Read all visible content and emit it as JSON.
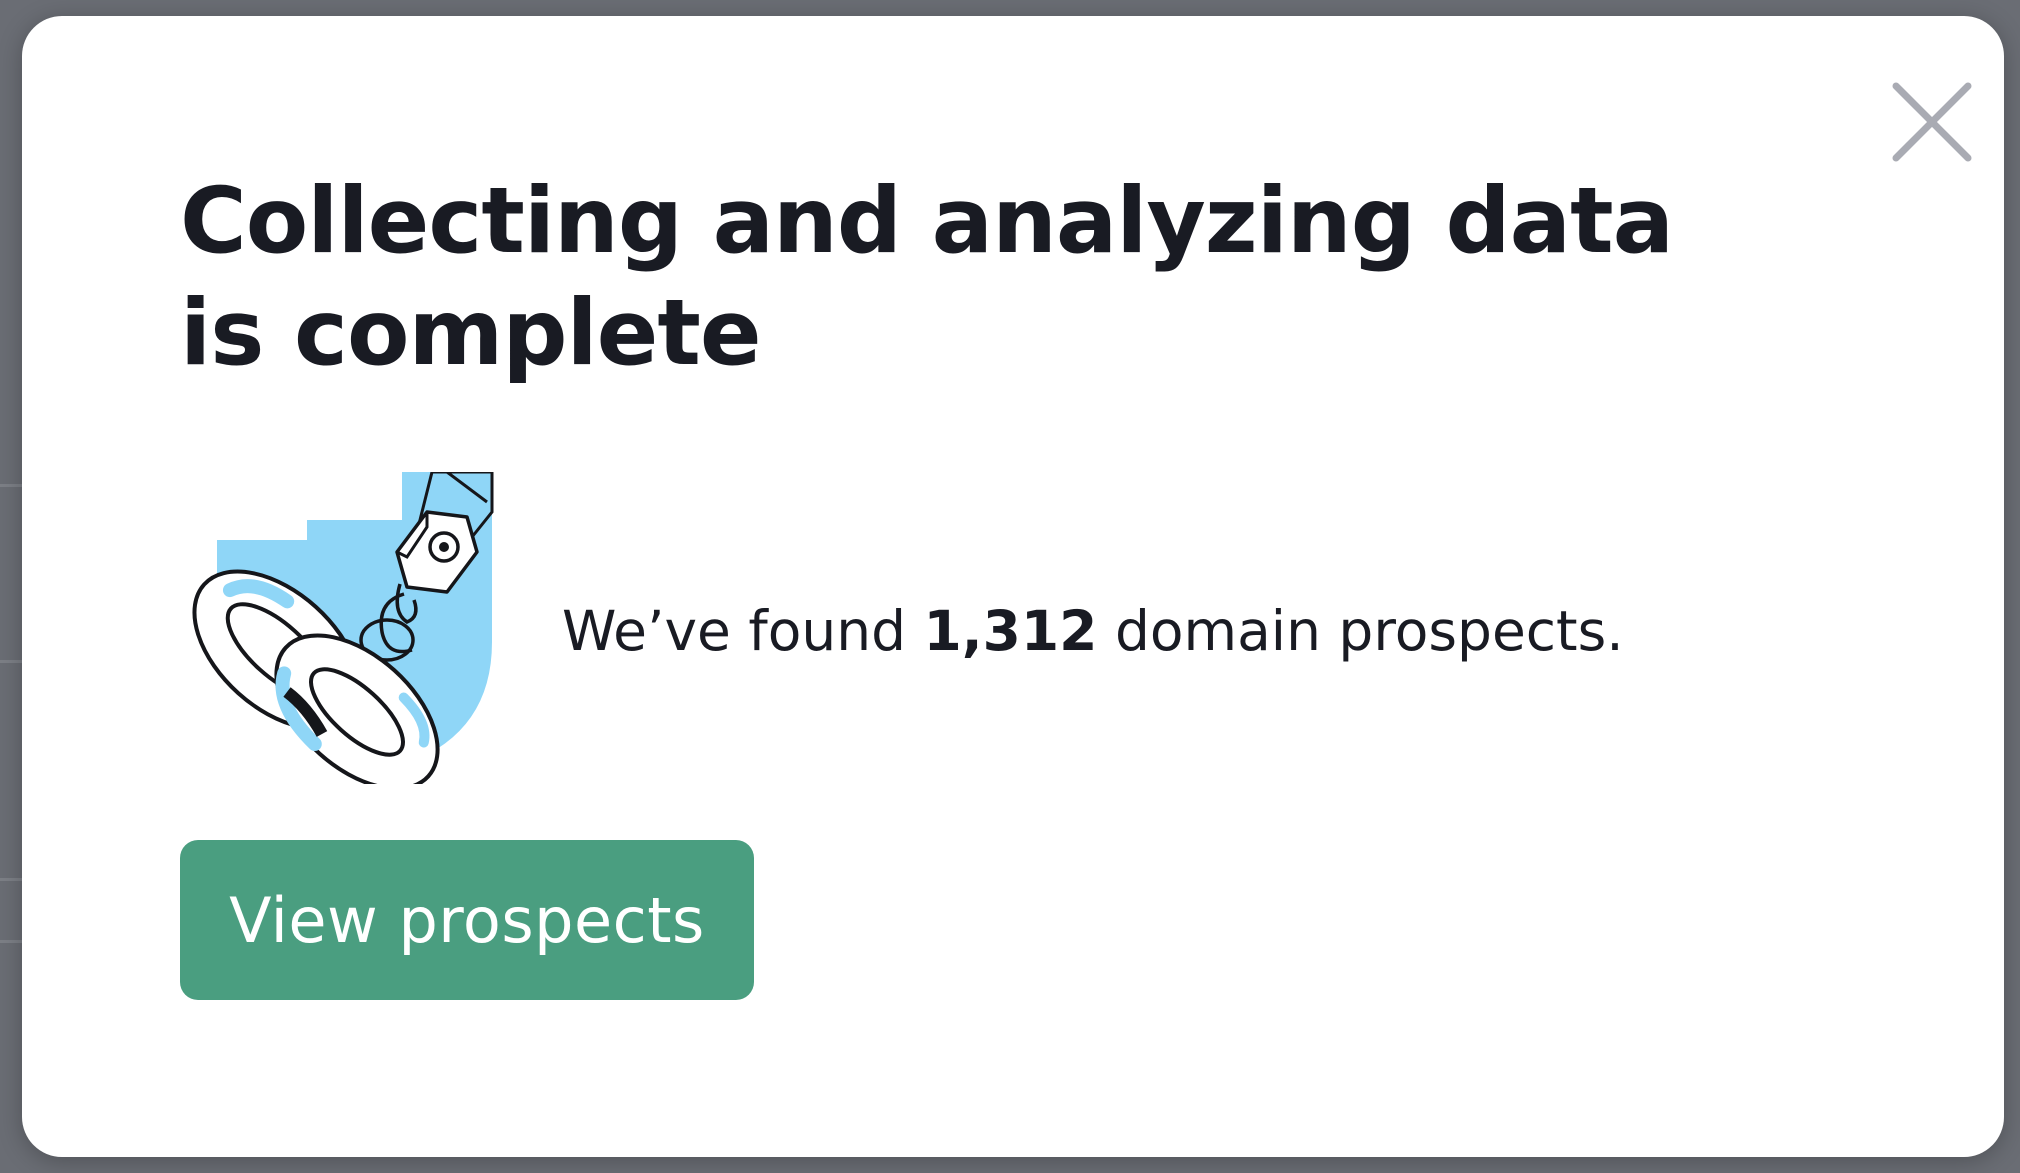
{
  "background": {
    "color": "#5c5f66"
  },
  "modal": {
    "title": "Collecting and analyzing data is complete",
    "message": {
      "prefix": "We’ve found ",
      "count": "1,312",
      "suffix": " domain prospects."
    },
    "primary_button_label": "View prospects",
    "close_icon": "close-icon",
    "illustration_icon": "chain-hook-illustration"
  },
  "colors": {
    "accent": "#4a9e80",
    "illustration_blue": "#8fd6f7",
    "title_text": "#191b23",
    "close_icon": "#a9abb3"
  }
}
